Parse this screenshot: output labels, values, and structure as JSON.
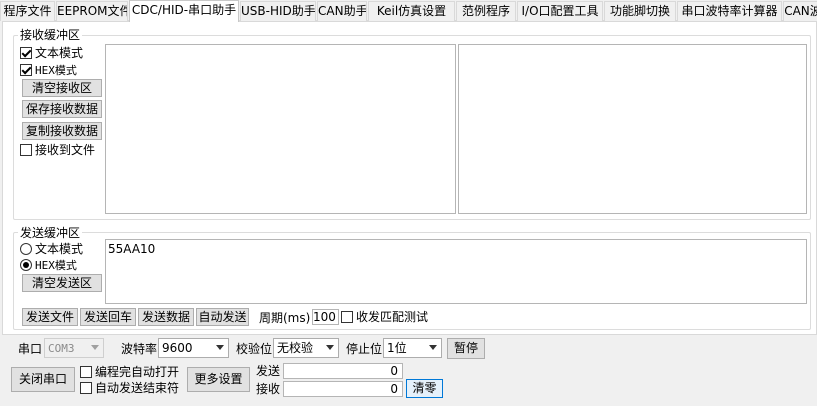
{
  "tabs": [
    {
      "label": "程序文件",
      "active": false
    },
    {
      "label": "EEPROM文件",
      "active": false
    },
    {
      "label": "CDC/HID-串口助手",
      "active": true
    },
    {
      "label": "USB-HID助手",
      "active": false
    },
    {
      "label": "CAN助手",
      "active": false
    },
    {
      "label": "Keil仿真设置",
      "active": false
    },
    {
      "label": "范例程序",
      "active": false
    },
    {
      "label": "I/O口配置工具",
      "active": false
    },
    {
      "label": "功能脚切换",
      "active": false
    },
    {
      "label": "串口波特率计算器",
      "active": false
    },
    {
      "label": "CAN波",
      "active": false
    }
  ],
  "receive": {
    "title": "接收缓冲区",
    "text_mode_label": "文本模式",
    "text_mode_checked": true,
    "hex_mode_label": "HEX模式",
    "hex_mode_checked": true,
    "clear_label": "清空接收区",
    "save_label": "保存接收数据",
    "copy_label": "复制接收数据",
    "to_file_label": "接收到文件",
    "to_file_checked": false
  },
  "send": {
    "title": "发送缓冲区",
    "text_mode_label": "文本模式",
    "hex_mode_label": "HEX模式",
    "selected_mode": "hex",
    "clear_label": "清空发送区",
    "content": "55AA10",
    "send_file_label": "发送文件",
    "send_enter_label": "发送回车",
    "send_data_label": "发送数据",
    "auto_send_label": "自动发送",
    "period_label": "周期(ms)",
    "period_value": "100",
    "match_test_label": "收发匹配测试"
  },
  "port": {
    "port_label": "串口",
    "port_value": "COM3",
    "baud_label": "波特率",
    "baud_value": "9600",
    "parity_label": "校验位",
    "parity_value": "无校验",
    "stop_label": "停止位",
    "stop_value": "1位",
    "pause_label": "暂停",
    "close_label": "关闭串口",
    "auto_open_label": "编程完自动打开",
    "auto_end_label": "自动发送结束符",
    "more_label": "更多设置",
    "sent_label": "发送",
    "sent_count": "0",
    "recv_label": "接收",
    "recv_count": "0",
    "reset_label": "清零"
  },
  "colors": {
    "focus_border": "#0078d7",
    "window_bg": "#f0f0f0"
  }
}
